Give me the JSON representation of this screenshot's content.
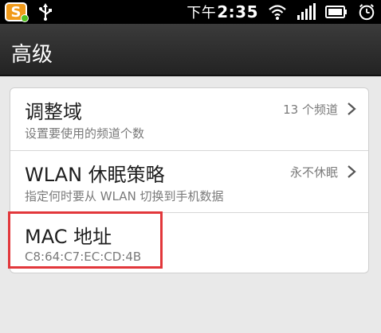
{
  "status_bar": {
    "app_icon_letter": "S",
    "ampm": "下午",
    "time": "2:35"
  },
  "title_bar": {
    "title": "高级"
  },
  "settings": [
    {
      "title": "调整域",
      "summary": "设置要使用的频道个数",
      "value": "13 个频道"
    },
    {
      "title": "WLAN 休眠策略",
      "summary": "指定何时要从 WLAN 切换到手机数据",
      "value": "永不休眠"
    },
    {
      "title": "MAC 地址",
      "summary": "C8:64:C7:EC:CD:4B",
      "value": ""
    }
  ],
  "colors": {
    "status_bar_bg": "#000000",
    "title_bar_bg": "#2f2f2f",
    "page_bg": "#e9e9e9",
    "panel_bg": "#ffffff",
    "highlight": "#e2373b",
    "app_icon_bg": "#f09a1a"
  },
  "icons": [
    "sogou-input-icon",
    "usb-icon",
    "wifi-icon",
    "signal-icon",
    "battery-icon",
    "alarm-icon",
    "chevron-right-icon"
  ]
}
